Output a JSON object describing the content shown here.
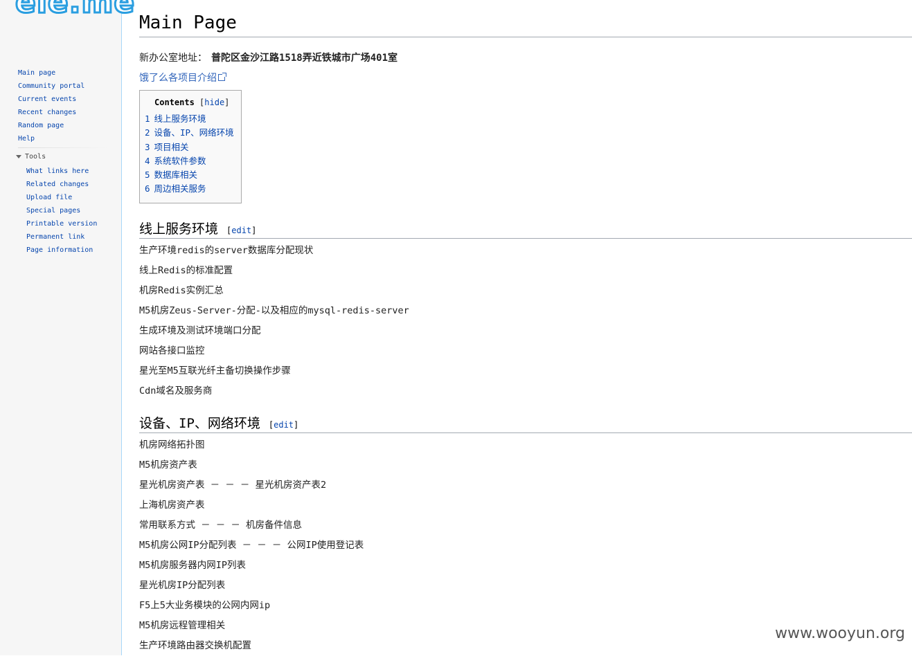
{
  "logo": {
    "text": "ele.me"
  },
  "sidebar": {
    "nav": [
      "Main page",
      "Community portal",
      "Current events",
      "Recent changes",
      "Random page",
      "Help"
    ],
    "tools_header": "Tools",
    "tools": [
      "What links here",
      "Related changes",
      "Upload file",
      "Special pages",
      "Printable version",
      "Permanent link",
      "Page information"
    ]
  },
  "page": {
    "title": "Main Page",
    "office_label": "新办公室地址：",
    "office_address": "普陀区金沙江路1518弄近铁城市广场401室",
    "intro_link": "饿了么各项目介绍"
  },
  "toc": {
    "title": "Contents",
    "hide_label": "hide",
    "items": [
      {
        "num": "1",
        "label": "线上服务环境"
      },
      {
        "num": "2",
        "label": "设备、IP、网络环境"
      },
      {
        "num": "3",
        "label": "项目相关"
      },
      {
        "num": "4",
        "label": "系统软件参数"
      },
      {
        "num": "5",
        "label": "数据库相关"
      },
      {
        "num": "6",
        "label": "周边相关服务"
      }
    ]
  },
  "sections": [
    {
      "heading": "线上服务环境",
      "edit_label": "edit",
      "links": [
        "生产环境redis的server数据库分配现状",
        "线上Redis的标准配置",
        "机房Redis实例汇总",
        "M5机房Zeus-Server-分配-以及相应的mysql-redis-server",
        "生成环境及测试环境端口分配",
        "网站各接口监控",
        "星光至M5互联光纤主备切换操作步骤",
        "Cdn域名及服务商"
      ]
    },
    {
      "heading": "设备、IP、网络环境",
      "edit_label": "edit",
      "links": [
        "机房网络拓扑图",
        "M5机房资产表",
        "星光机房资产表 － － － 星光机房资产表2",
        "上海机房资产表",
        "常用联系方式 － － － 机房备件信息",
        "M5机房公网IP分配列表 － － － 公网IP使用登记表",
        "M5机房服务器内网IP列表",
        "星光机房IP分配列表",
        "F5上5大业务模块的公网内网ip",
        "M5机房远程管理相关",
        "生产环境路由器交换机配置"
      ]
    }
  ],
  "watermark": "www.wooyun.org"
}
